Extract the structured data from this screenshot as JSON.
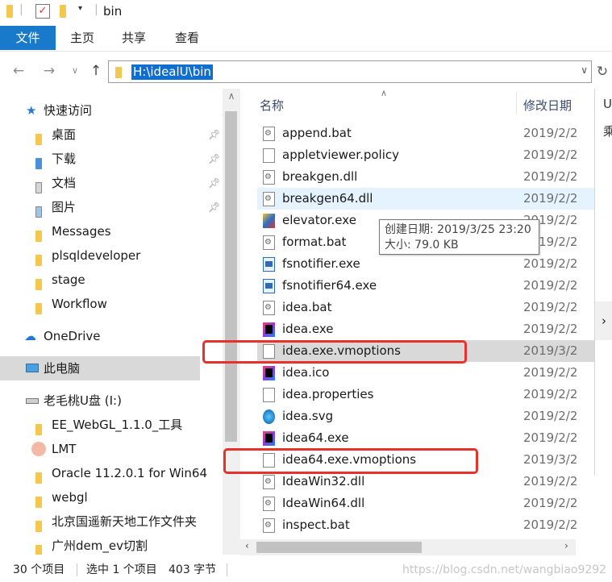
{
  "window": {
    "title": "bin"
  },
  "ribbon": {
    "tabs": [
      "文件",
      "主页",
      "共享",
      "查看"
    ]
  },
  "address": {
    "path": "H:\\idealU\\bin"
  },
  "nav": {
    "quick_access": "快速访问",
    "quick_items": [
      {
        "label": "桌面",
        "pinned": true
      },
      {
        "label": "下载",
        "pinned": true
      },
      {
        "label": "文档",
        "pinned": true
      },
      {
        "label": "图片",
        "pinned": true
      },
      {
        "label": "Messages"
      },
      {
        "label": "plsqldeveloper"
      },
      {
        "label": "stage"
      },
      {
        "label": "Workflow"
      }
    ],
    "onedrive": "OneDrive",
    "this_pc": "此电脑",
    "drive": "老毛桃U盘 (I:)",
    "drive_items": [
      {
        "label": "EE_WebGL_1.1.0_工具"
      },
      {
        "label": "LMT"
      },
      {
        "label": "Oracle 11.2.0.1 for Win64"
      },
      {
        "label": "webgl"
      },
      {
        "label": "北京国遥新天地工作文件夹"
      },
      {
        "label": "广州dem_ev切割"
      }
    ]
  },
  "columns": {
    "name": "名称",
    "date": "修改日期"
  },
  "files": [
    {
      "name": "append.bat",
      "date": "2019/2/2",
      "icon": "gear-file-icon"
    },
    {
      "name": "appletviewer.policy",
      "date": "2019/2/2",
      "icon": "file-icon"
    },
    {
      "name": "breakgen.dll",
      "date": "2019/2/2",
      "icon": "gear-file-icon"
    },
    {
      "name": "breakgen64.dll",
      "date": "2019/2/2",
      "icon": "gear-file-icon"
    },
    {
      "name": "elevator.exe",
      "date": "2019/2/2",
      "icon": "elevator-icon"
    },
    {
      "name": "format.bat",
      "date": "2019/2/2",
      "icon": "gear-file-icon"
    },
    {
      "name": "fsnotifier.exe",
      "date": "2019/2/2",
      "icon": "app-icon"
    },
    {
      "name": "fsnotifier64.exe",
      "date": "2019/2/2",
      "icon": "app-icon"
    },
    {
      "name": "idea.bat",
      "date": "2019/2/2",
      "icon": "gear-file-icon"
    },
    {
      "name": "idea.exe",
      "date": "2019/2/2",
      "icon": "intellij-icon"
    },
    {
      "name": "idea.exe.vmoptions",
      "date": "2019/3/2",
      "icon": "file-icon"
    },
    {
      "name": "idea.ico",
      "date": "2019/2/2",
      "icon": "intellij-icon"
    },
    {
      "name": "idea.properties",
      "date": "2019/2/2",
      "icon": "file-icon"
    },
    {
      "name": "idea.svg",
      "date": "2019/2/2",
      "icon": "edge-icon"
    },
    {
      "name": "idea64.exe",
      "date": "2019/2/2",
      "icon": "intellij-icon"
    },
    {
      "name": "idea64.exe.vmoptions",
      "date": "2019/3/2",
      "icon": "file-icon"
    },
    {
      "name": "IdeaWin32.dll",
      "date": "2019/2/2",
      "icon": "gear-file-icon"
    },
    {
      "name": "IdeaWin64.dll",
      "date": "2019/2/2",
      "icon": "gear-file-icon"
    },
    {
      "name": "inspect.bat",
      "date": "2019/2/2",
      "icon": "gear-file-icon"
    }
  ],
  "tooltip": {
    "created": "创建日期: 2019/3/25 23:20",
    "size": "大小: 79.0 KB"
  },
  "right_pane": {
    "c1": "U",
    "c2": "乘",
    "next": "›"
  },
  "status": {
    "count": "30 个项目",
    "selected": "选中 1 个项目",
    "size": "403 字节"
  },
  "watermark": "https://blog.csdn.net/wangbiao9292"
}
